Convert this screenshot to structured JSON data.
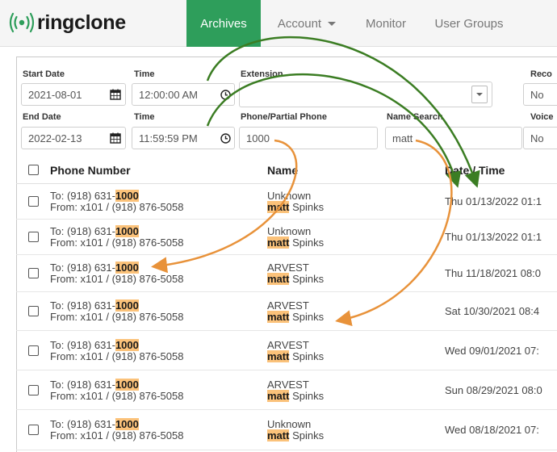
{
  "nav": {
    "logo": "ringclone",
    "tabs": [
      {
        "label": "Archives",
        "active": true
      },
      {
        "label": "Account",
        "dropdown": true
      },
      {
        "label": "Monitor"
      },
      {
        "label": "User Groups"
      }
    ]
  },
  "filters": {
    "start_date": {
      "label": "Start Date",
      "value": "2021-08-01"
    },
    "start_time": {
      "label": "Time",
      "value": "12:00:00 AM"
    },
    "end_date": {
      "label": "End Date",
      "value": "2022-02-13"
    },
    "end_time": {
      "label": "Time",
      "value": "11:59:59 PM"
    },
    "extension": {
      "label": "Extension",
      "value": ""
    },
    "phone": {
      "label": "Phone/Partial Phone",
      "value": "1000"
    },
    "name_search": {
      "label": "Name Search",
      "value": "matt"
    },
    "recordings": {
      "label": "Reco",
      "value": "No"
    },
    "voicemail": {
      "label": "Voice",
      "value": "No"
    }
  },
  "table": {
    "columns": [
      "Phone Number",
      "Name",
      "Date / Time"
    ],
    "rows": [
      {
        "to_prefix": "To: (918) 631-",
        "to_match": "1000",
        "from": "From: x101 / (918) 876-5058",
        "name1": "Unknown",
        "name_match": "matt",
        "name_rest": " Spinks",
        "datetime": "Thu 01/13/2022 01:1"
      },
      {
        "to_prefix": "To: (918) 631-",
        "to_match": "1000",
        "from": "From: x101 / (918) 876-5058",
        "name1": "Unknown",
        "name_match": "matt",
        "name_rest": " Spinks",
        "datetime": "Thu 01/13/2022 01:1"
      },
      {
        "to_prefix": "To: (918) 631-",
        "to_match": "1000",
        "from": "From: x101 / (918) 876-5058",
        "name1": "ARVEST",
        "name_match": "matt",
        "name_rest": " Spinks",
        "datetime": "Thu 11/18/2021 08:0"
      },
      {
        "to_prefix": "To: (918) 631-",
        "to_match": "1000",
        "from": "From: x101 / (918) 876-5058",
        "name1": "ARVEST",
        "name_match": "matt",
        "name_rest": " Spinks",
        "datetime": "Sat 10/30/2021 08:4"
      },
      {
        "to_prefix": "To: (918) 631-",
        "to_match": "1000",
        "from": "From: x101 / (918) 876-5058",
        "name1": "ARVEST",
        "name_match": "matt",
        "name_rest": " Spinks",
        "datetime": "Wed 09/01/2021 07:"
      },
      {
        "to_prefix": "To: (918) 631-",
        "to_match": "1000",
        "from": "From: x101 / (918) 876-5058",
        "name1": "ARVEST",
        "name_match": "matt",
        "name_rest": " Spinks",
        "datetime": "Sun 08/29/2021 08:0"
      },
      {
        "to_prefix": "To: (918) 631-",
        "to_match": "1000",
        "from": "From: x101 / (918) 876-5058",
        "name1": "Unknown",
        "name_match": "matt",
        "name_rest": " Spinks",
        "datetime": "Wed 08/18/2021 07:"
      }
    ]
  },
  "colors": {
    "brand_green": "#2e9e5b",
    "highlight": "#fbc27a",
    "arrow_green": "#3b7d23",
    "arrow_orange": "#e8923a"
  },
  "icons": [
    "signal-icon",
    "calendar-icon",
    "clock-icon",
    "chevron-down-icon",
    "checkbox-icon"
  ]
}
